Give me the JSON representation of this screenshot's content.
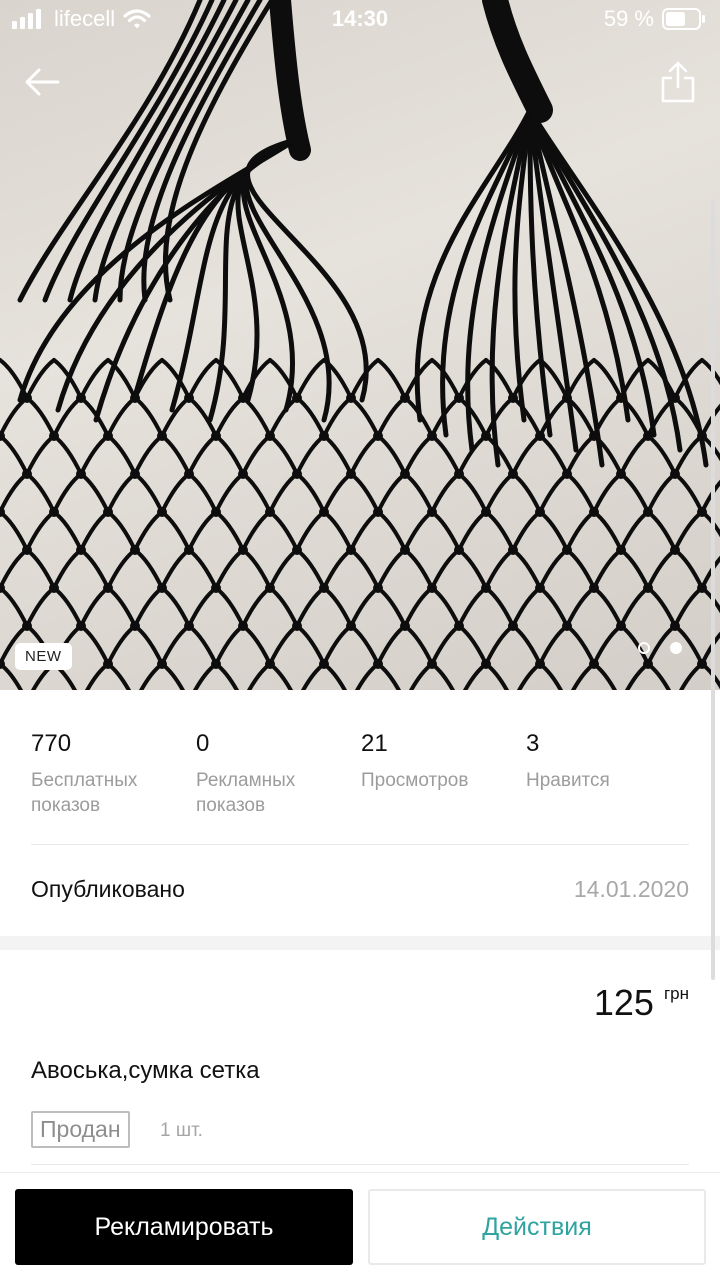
{
  "status_bar": {
    "carrier": "lifecell",
    "time": "14:30",
    "battery": "59 %"
  },
  "hero": {
    "badge": "NEW",
    "image_subject": "black macrame net bag",
    "pagination": {
      "count": 2,
      "active": 2
    }
  },
  "nav": {
    "back_icon": "arrow-left-icon",
    "share_icon": "share-icon"
  },
  "stats": [
    {
      "value": "770",
      "label": "Бесплатных показов"
    },
    {
      "value": "0",
      "label": "Рекламных показов"
    },
    {
      "value": "21",
      "label": "Просмотров"
    },
    {
      "value": "3",
      "label": "Нравится"
    }
  ],
  "published": {
    "label": "Опубликовано",
    "date": "14.01.2020"
  },
  "listing": {
    "price": "125",
    "currency": "грн",
    "title": "Авоська,сумка сетка",
    "status": "Продан",
    "quantity": "1 шт."
  },
  "actions": {
    "promote": "Рекламировать",
    "actions": "Действия"
  },
  "colors": {
    "accent": "#2fa3a0",
    "primary_button": "#000000",
    "muted_text": "#9c9c9c"
  }
}
